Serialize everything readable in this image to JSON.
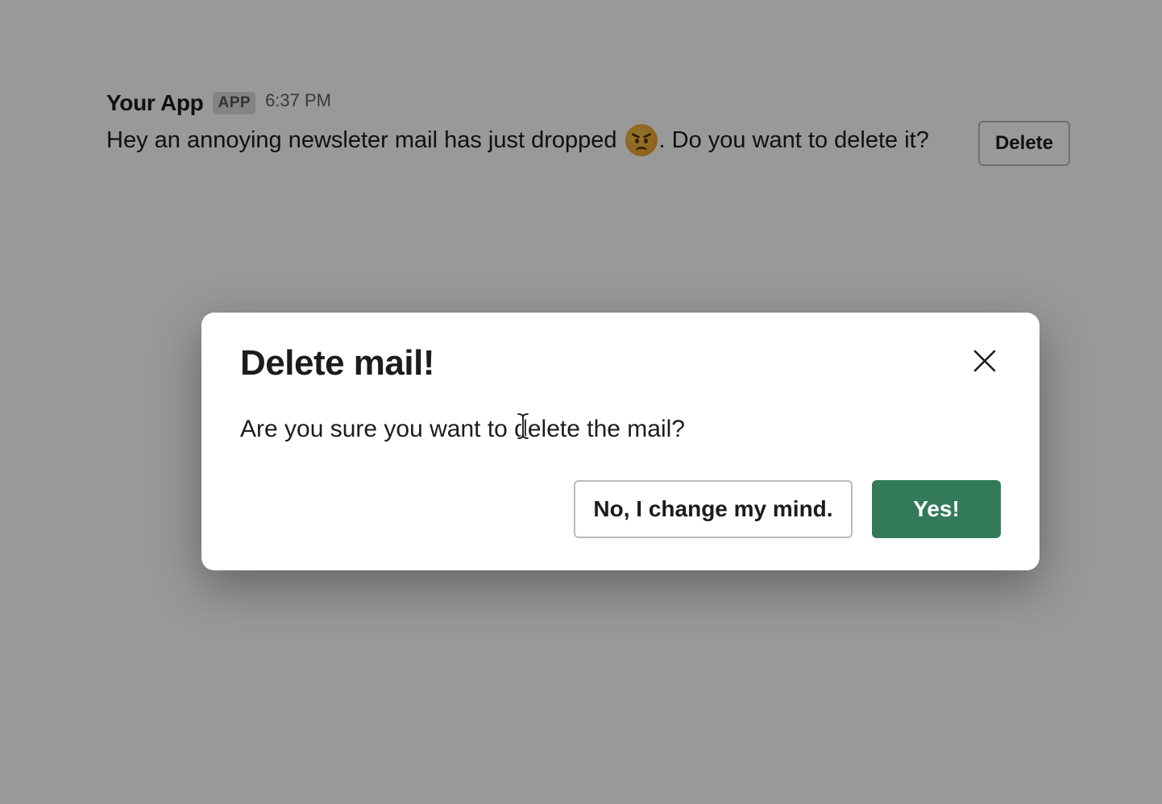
{
  "message": {
    "app_name": "Your App",
    "badge": "APP",
    "timestamp": "6:37 PM",
    "text_before": "Hey an annoying newsleter mail has just dropped",
    "emoji": "angry-face-emoji",
    "text_after": ". Do you want to delete it?",
    "delete_label": "Delete"
  },
  "modal": {
    "title": "Delete mail!",
    "text": "Are you sure you want to delete the mail?",
    "cancel_label": "No, I change my mind.",
    "confirm_label": "Yes!",
    "close_icon": "close-icon"
  },
  "colors": {
    "primary_button": "#327a5a",
    "overlay": "rgba(0,0,0,0.40)"
  }
}
